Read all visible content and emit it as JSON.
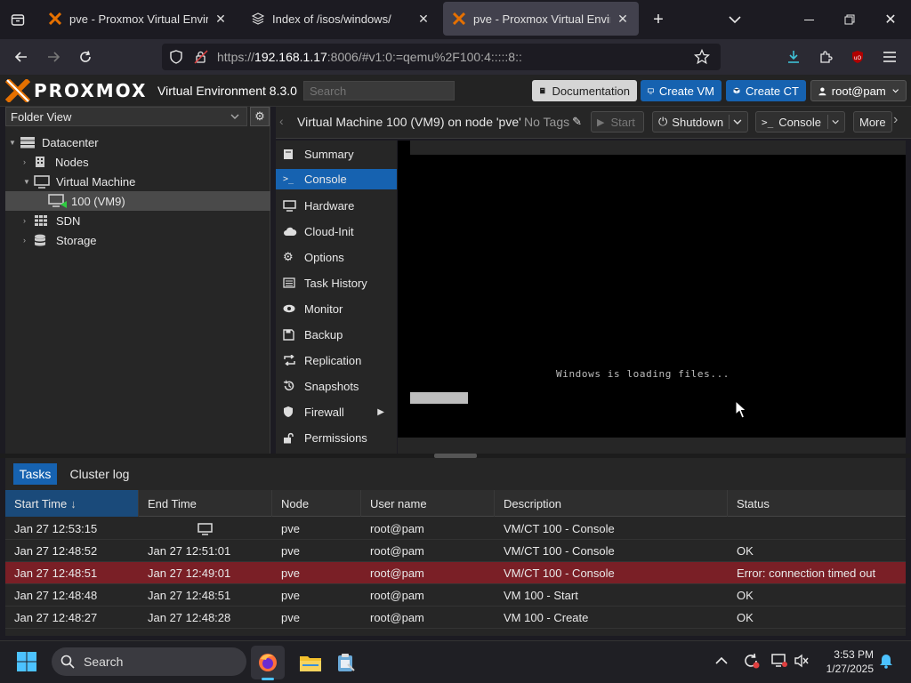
{
  "browser": {
    "tabs": [
      {
        "label": "pve - Proxmox Virtual Environm",
        "active": false
      },
      {
        "label": "Index of /isos/windows/",
        "active": false
      },
      {
        "label": "pve - Proxmox Virtual Environm",
        "active": true
      }
    ],
    "url": {
      "prefix": "https://",
      "host": "192.168.1.17",
      "rest": ":8006/#v1:0:=qemu%2F100:4:::::8::"
    }
  },
  "pve": {
    "logo": "PROXMOX",
    "product": "Virtual Environment 8.3.0",
    "search_placeholder": "Search",
    "buttons": {
      "documentation": "Documentation",
      "create_vm": "Create VM",
      "create_ct": "Create CT",
      "user": "root@pam"
    },
    "colors": {
      "accent": "#1662b0",
      "brand_orange": "#e57000",
      "error_row": "#7a1f26"
    }
  },
  "tree": {
    "view": "Folder View",
    "items": [
      {
        "label": "Datacenter",
        "icon": "server-rack-icon"
      },
      {
        "label": "Nodes",
        "icon": "building-icon"
      },
      {
        "label": "Virtual Machine",
        "icon": "monitor-icon"
      },
      {
        "label": "100 (VM9)",
        "icon": "vm-running-icon"
      },
      {
        "label": "SDN",
        "icon": "grid-icon"
      },
      {
        "label": "Storage",
        "icon": "database-icon"
      }
    ]
  },
  "vm": {
    "title": "Virtual Machine 100 (VM9) on node 'pve'",
    "tags": "No Tags",
    "buttons": {
      "start": "Start",
      "shutdown": "Shutdown",
      "console": "Console",
      "more": "More"
    }
  },
  "menu": [
    {
      "label": "Summary"
    },
    {
      "label": "Console"
    },
    {
      "label": "Hardware"
    },
    {
      "label": "Cloud-Init"
    },
    {
      "label": "Options"
    },
    {
      "label": "Task History"
    },
    {
      "label": "Monitor"
    },
    {
      "label": "Backup"
    },
    {
      "label": "Replication"
    },
    {
      "label": "Snapshots"
    },
    {
      "label": "Firewall"
    },
    {
      "label": "Permissions"
    }
  ],
  "console": {
    "message": "Windows is loading files..."
  },
  "tasks": {
    "tabs": [
      "Tasks",
      "Cluster log"
    ],
    "headers": [
      "Start Time",
      "End Time",
      "Node",
      "User name",
      "Description",
      "Status"
    ],
    "rows": [
      {
        "start": "Jan 27 12:53:15",
        "end": "",
        "node": "pve",
        "user": "root@pam",
        "desc": "VM/CT 100 - Console",
        "status": ""
      },
      {
        "start": "Jan 27 12:48:52",
        "end": "Jan 27 12:51:01",
        "node": "pve",
        "user": "root@pam",
        "desc": "VM/CT 100 - Console",
        "status": "OK"
      },
      {
        "start": "Jan 27 12:48:51",
        "end": "Jan 27 12:49:01",
        "node": "pve",
        "user": "root@pam",
        "desc": "VM/CT 100 - Console",
        "status": "Error: connection timed out"
      },
      {
        "start": "Jan 27 12:48:48",
        "end": "Jan 27 12:48:51",
        "node": "pve",
        "user": "root@pam",
        "desc": "VM 100 - Start",
        "status": "OK"
      },
      {
        "start": "Jan 27 12:48:27",
        "end": "Jan 27 12:48:28",
        "node": "pve",
        "user": "root@pam",
        "desc": "VM 100 - Create",
        "status": "OK"
      }
    ]
  },
  "taskbar": {
    "search": "Search",
    "time": "3:53 PM",
    "date": "1/27/2025"
  }
}
